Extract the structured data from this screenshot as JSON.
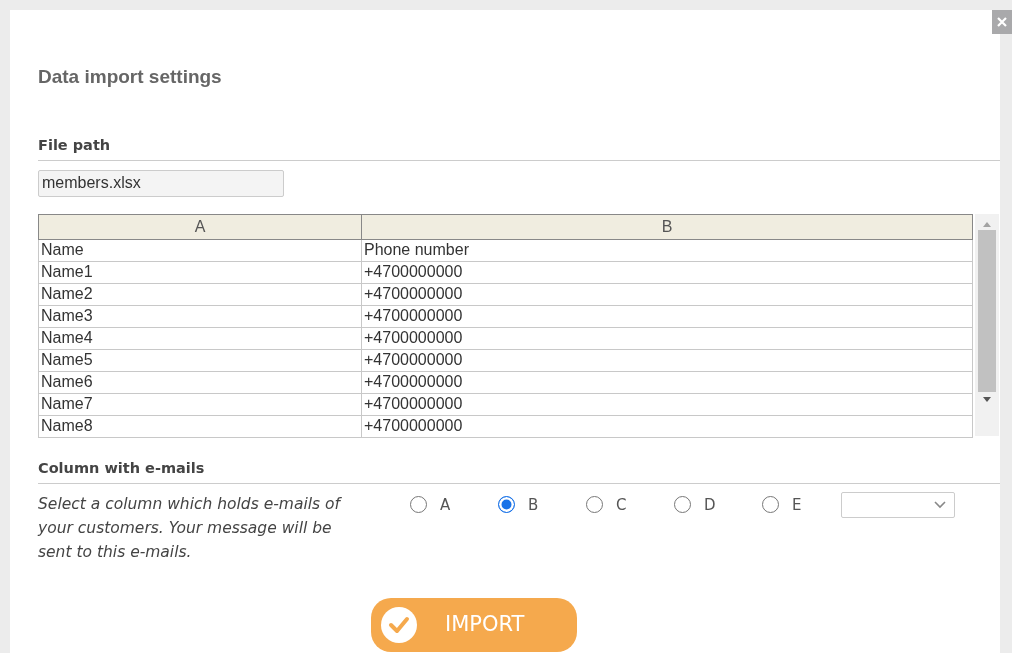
{
  "dialog": {
    "title": "Data import settings"
  },
  "file_path": {
    "label": "File path",
    "value": "members.xlsx"
  },
  "table": {
    "columns": [
      "A",
      "B"
    ],
    "rows": [
      [
        "Name",
        "Phone number"
      ],
      [
        "Name1",
        "+4700000000"
      ],
      [
        "Name2",
        "+4700000000"
      ],
      [
        "Name3",
        "+4700000000"
      ],
      [
        "Name4",
        "+4700000000"
      ],
      [
        "Name5",
        "+4700000000"
      ],
      [
        "Name6",
        "+4700000000"
      ],
      [
        "Name7",
        "+4700000000"
      ],
      [
        "Name8",
        "+4700000000"
      ]
    ]
  },
  "email_column": {
    "label": "Column with e-mails",
    "description": "Select a column which holds e-mails of your customers. Your message will be sent to this e-mails.",
    "options": [
      {
        "label": "A",
        "selected": false
      },
      {
        "label": "B",
        "selected": true
      },
      {
        "label": "C",
        "selected": false
      },
      {
        "label": "D",
        "selected": false
      },
      {
        "label": "E",
        "selected": false
      }
    ]
  },
  "import_button": {
    "label": "IMPORT"
  }
}
